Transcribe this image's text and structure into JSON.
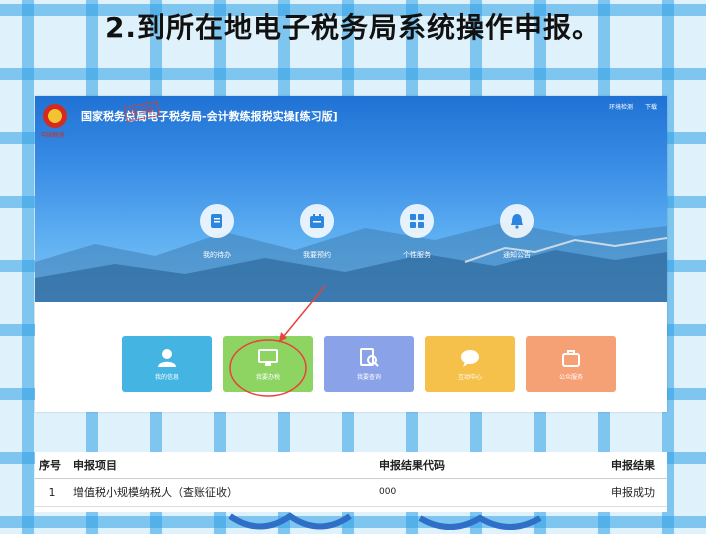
{
  "heading": "2.到所在地电子税务局系统操作申报。",
  "system": {
    "title": "国家税务总局电子税务局-会计教练报税实操[练习版]",
    "stamp": "练习版",
    "emblem_caption": "中国税务",
    "top_links": [
      "环境检测",
      "下载"
    ]
  },
  "features": [
    {
      "label": "我的待办",
      "icon": "todo-doc-icon"
    },
    {
      "label": "我要预约",
      "icon": "calendar-icon"
    },
    {
      "label": "个性服务",
      "icon": "grid-icon"
    },
    {
      "label": "通知公告",
      "icon": "bell-icon"
    }
  ],
  "tiles": [
    {
      "label": "我的信息",
      "icon": "user-icon",
      "color": "#44b5e2"
    },
    {
      "label": "我要办税",
      "icon": "monitor-icon",
      "color": "#8ed462"
    },
    {
      "label": "我要查询",
      "icon": "search-doc-icon",
      "color": "#8aa2e8"
    },
    {
      "label": "互动中心",
      "icon": "chat-icon",
      "color": "#f5c14a"
    },
    {
      "label": "公众服务",
      "icon": "service-icon",
      "color": "#f6a076"
    }
  ],
  "table": {
    "headers": [
      "序号",
      "申报项目",
      "申报结果代码",
      "申报结果"
    ],
    "rows": [
      {
        "no": "1",
        "item": "增值税小规模纳税人（查账征收）",
        "code": "000",
        "result": "申报成功"
      }
    ]
  },
  "colors": {
    "banner_top": "#1f72d4",
    "annotation_red": "#e8423a"
  }
}
